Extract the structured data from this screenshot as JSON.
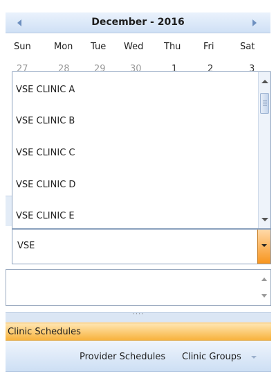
{
  "calendar": {
    "title": "December - 2016",
    "weekdays": [
      "Sun",
      "Mon",
      "Tue",
      "Wed",
      "Thu",
      "Fri",
      "Sat"
    ],
    "first_row_days": [
      "27",
      "28",
      "29",
      "30",
      "1",
      "2",
      "3"
    ]
  },
  "dropdown": {
    "items": [
      "VSE CLINIC A",
      "VSE CLINIC B",
      "VSE CLINIC C",
      "VSE CLINIC D",
      "VSE CLINIC E"
    ]
  },
  "combo": {
    "value": "VSE"
  },
  "navbar": {
    "active_group": "Clinic Schedules",
    "links": [
      "Provider Schedules",
      "Clinic Groups"
    ]
  },
  "colors": {
    "accent_orange": "#f8b33e",
    "header_blue": "#cfe0f5"
  }
}
